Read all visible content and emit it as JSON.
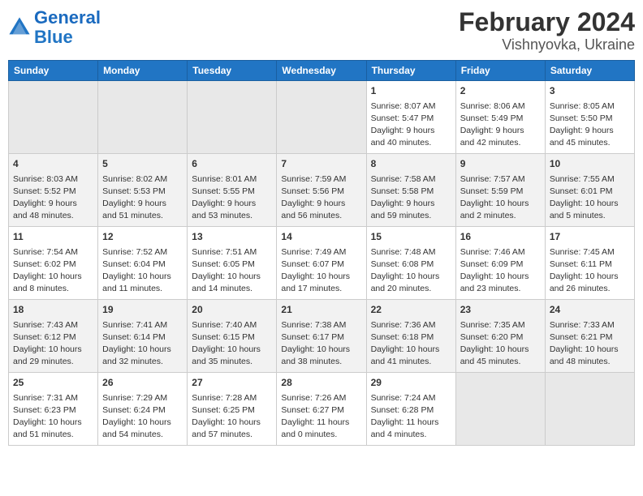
{
  "header": {
    "logo_general": "General",
    "logo_blue": "Blue",
    "title": "February 2024",
    "subtitle": "Vishnyovka, Ukraine"
  },
  "weekdays": [
    "Sunday",
    "Monday",
    "Tuesday",
    "Wednesday",
    "Thursday",
    "Friday",
    "Saturday"
  ],
  "weeks": [
    [
      {
        "day": "",
        "info": ""
      },
      {
        "day": "",
        "info": ""
      },
      {
        "day": "",
        "info": ""
      },
      {
        "day": "",
        "info": ""
      },
      {
        "day": "1",
        "info": "Sunrise: 8:07 AM\nSunset: 5:47 PM\nDaylight: 9 hours\nand 40 minutes."
      },
      {
        "day": "2",
        "info": "Sunrise: 8:06 AM\nSunset: 5:49 PM\nDaylight: 9 hours\nand 42 minutes."
      },
      {
        "day": "3",
        "info": "Sunrise: 8:05 AM\nSunset: 5:50 PM\nDaylight: 9 hours\nand 45 minutes."
      }
    ],
    [
      {
        "day": "4",
        "info": "Sunrise: 8:03 AM\nSunset: 5:52 PM\nDaylight: 9 hours\nand 48 minutes."
      },
      {
        "day": "5",
        "info": "Sunrise: 8:02 AM\nSunset: 5:53 PM\nDaylight: 9 hours\nand 51 minutes."
      },
      {
        "day": "6",
        "info": "Sunrise: 8:01 AM\nSunset: 5:55 PM\nDaylight: 9 hours\nand 53 minutes."
      },
      {
        "day": "7",
        "info": "Sunrise: 7:59 AM\nSunset: 5:56 PM\nDaylight: 9 hours\nand 56 minutes."
      },
      {
        "day": "8",
        "info": "Sunrise: 7:58 AM\nSunset: 5:58 PM\nDaylight: 9 hours\nand 59 minutes."
      },
      {
        "day": "9",
        "info": "Sunrise: 7:57 AM\nSunset: 5:59 PM\nDaylight: 10 hours\nand 2 minutes."
      },
      {
        "day": "10",
        "info": "Sunrise: 7:55 AM\nSunset: 6:01 PM\nDaylight: 10 hours\nand 5 minutes."
      }
    ],
    [
      {
        "day": "11",
        "info": "Sunrise: 7:54 AM\nSunset: 6:02 PM\nDaylight: 10 hours\nand 8 minutes."
      },
      {
        "day": "12",
        "info": "Sunrise: 7:52 AM\nSunset: 6:04 PM\nDaylight: 10 hours\nand 11 minutes."
      },
      {
        "day": "13",
        "info": "Sunrise: 7:51 AM\nSunset: 6:05 PM\nDaylight: 10 hours\nand 14 minutes."
      },
      {
        "day": "14",
        "info": "Sunrise: 7:49 AM\nSunset: 6:07 PM\nDaylight: 10 hours\nand 17 minutes."
      },
      {
        "day": "15",
        "info": "Sunrise: 7:48 AM\nSunset: 6:08 PM\nDaylight: 10 hours\nand 20 minutes."
      },
      {
        "day": "16",
        "info": "Sunrise: 7:46 AM\nSunset: 6:09 PM\nDaylight: 10 hours\nand 23 minutes."
      },
      {
        "day": "17",
        "info": "Sunrise: 7:45 AM\nSunset: 6:11 PM\nDaylight: 10 hours\nand 26 minutes."
      }
    ],
    [
      {
        "day": "18",
        "info": "Sunrise: 7:43 AM\nSunset: 6:12 PM\nDaylight: 10 hours\nand 29 minutes."
      },
      {
        "day": "19",
        "info": "Sunrise: 7:41 AM\nSunset: 6:14 PM\nDaylight: 10 hours\nand 32 minutes."
      },
      {
        "day": "20",
        "info": "Sunrise: 7:40 AM\nSunset: 6:15 PM\nDaylight: 10 hours\nand 35 minutes."
      },
      {
        "day": "21",
        "info": "Sunrise: 7:38 AM\nSunset: 6:17 PM\nDaylight: 10 hours\nand 38 minutes."
      },
      {
        "day": "22",
        "info": "Sunrise: 7:36 AM\nSunset: 6:18 PM\nDaylight: 10 hours\nand 41 minutes."
      },
      {
        "day": "23",
        "info": "Sunrise: 7:35 AM\nSunset: 6:20 PM\nDaylight: 10 hours\nand 45 minutes."
      },
      {
        "day": "24",
        "info": "Sunrise: 7:33 AM\nSunset: 6:21 PM\nDaylight: 10 hours\nand 48 minutes."
      }
    ],
    [
      {
        "day": "25",
        "info": "Sunrise: 7:31 AM\nSunset: 6:23 PM\nDaylight: 10 hours\nand 51 minutes."
      },
      {
        "day": "26",
        "info": "Sunrise: 7:29 AM\nSunset: 6:24 PM\nDaylight: 10 hours\nand 54 minutes."
      },
      {
        "day": "27",
        "info": "Sunrise: 7:28 AM\nSunset: 6:25 PM\nDaylight: 10 hours\nand 57 minutes."
      },
      {
        "day": "28",
        "info": "Sunrise: 7:26 AM\nSunset: 6:27 PM\nDaylight: 11 hours\nand 0 minutes."
      },
      {
        "day": "29",
        "info": "Sunrise: 7:24 AM\nSunset: 6:28 PM\nDaylight: 11 hours\nand 4 minutes."
      },
      {
        "day": "",
        "info": ""
      },
      {
        "day": "",
        "info": ""
      }
    ]
  ]
}
